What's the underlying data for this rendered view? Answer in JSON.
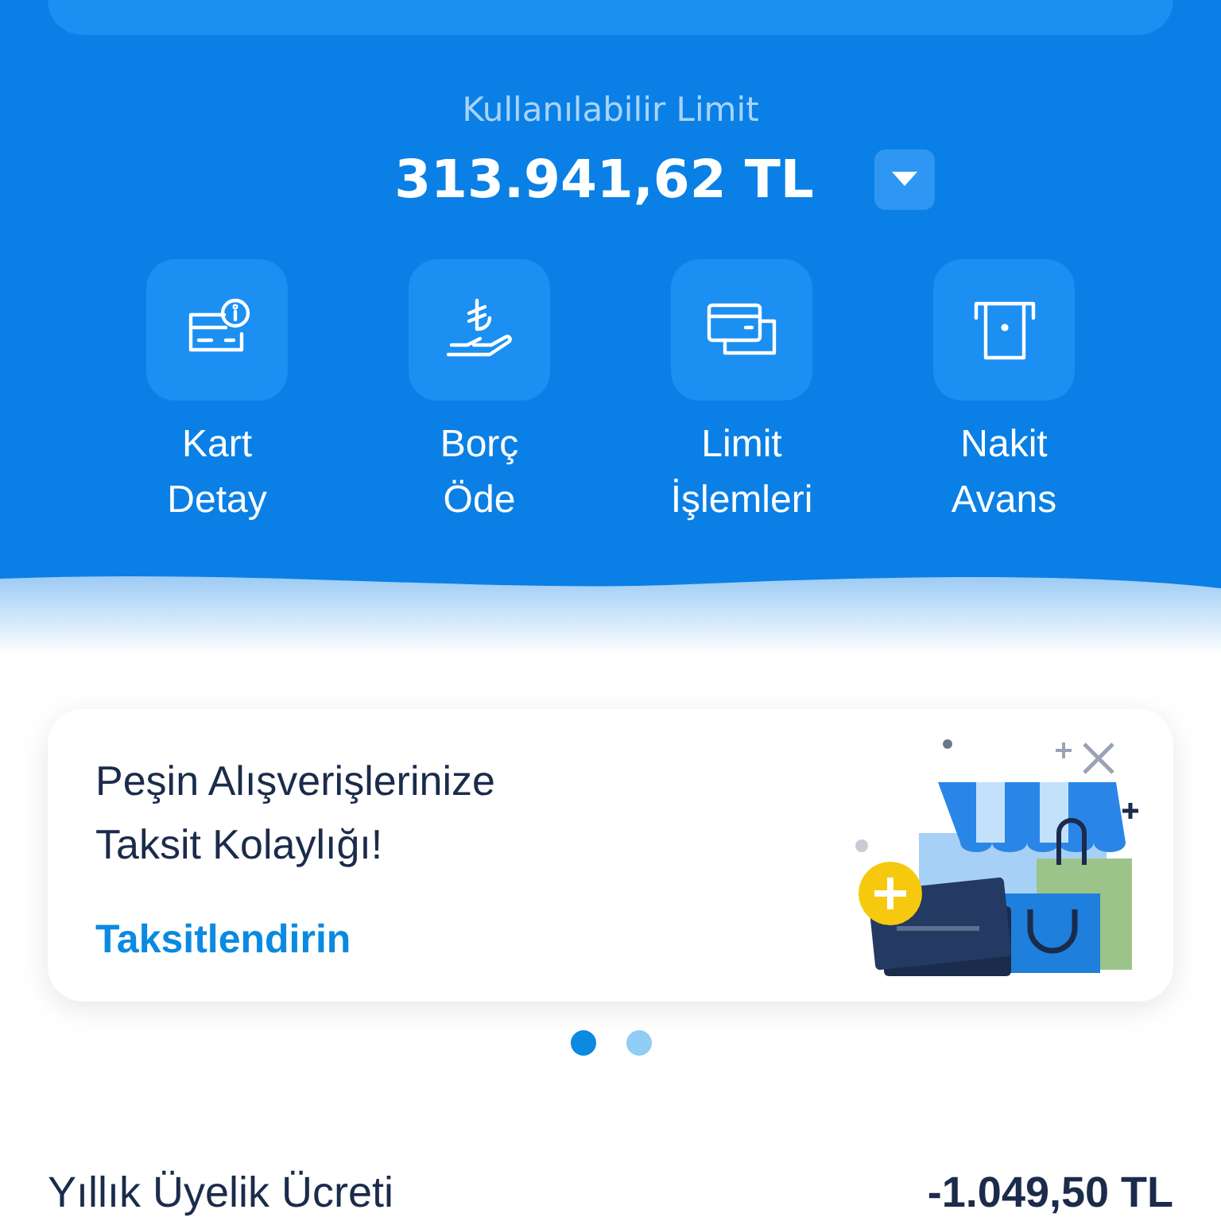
{
  "limit": {
    "label": "Kullanılabilir Limit",
    "amount": "313.941,62 TL"
  },
  "actions": [
    {
      "kind": "card-info",
      "label": [
        "Kart",
        "Detay"
      ]
    },
    {
      "kind": "lira-hand",
      "label": [
        "Borç",
        "Öde"
      ]
    },
    {
      "kind": "cards",
      "label": [
        "Limit",
        "İşlemleri"
      ]
    },
    {
      "kind": "atm",
      "label": [
        "Nakit",
        "Avans"
      ]
    }
  ],
  "banner": {
    "title": [
      "Peşin Alışverişlerinize",
      "Taksit Kolaylığı!"
    ],
    "link": "Taksitlendirin"
  },
  "carousel_dots": [
    {
      "selected": true
    },
    {
      "selected": false
    }
  ],
  "summary_row": {
    "label": "Yıllık Üyelik Ücreti",
    "value": "-1.049,50 TL"
  }
}
